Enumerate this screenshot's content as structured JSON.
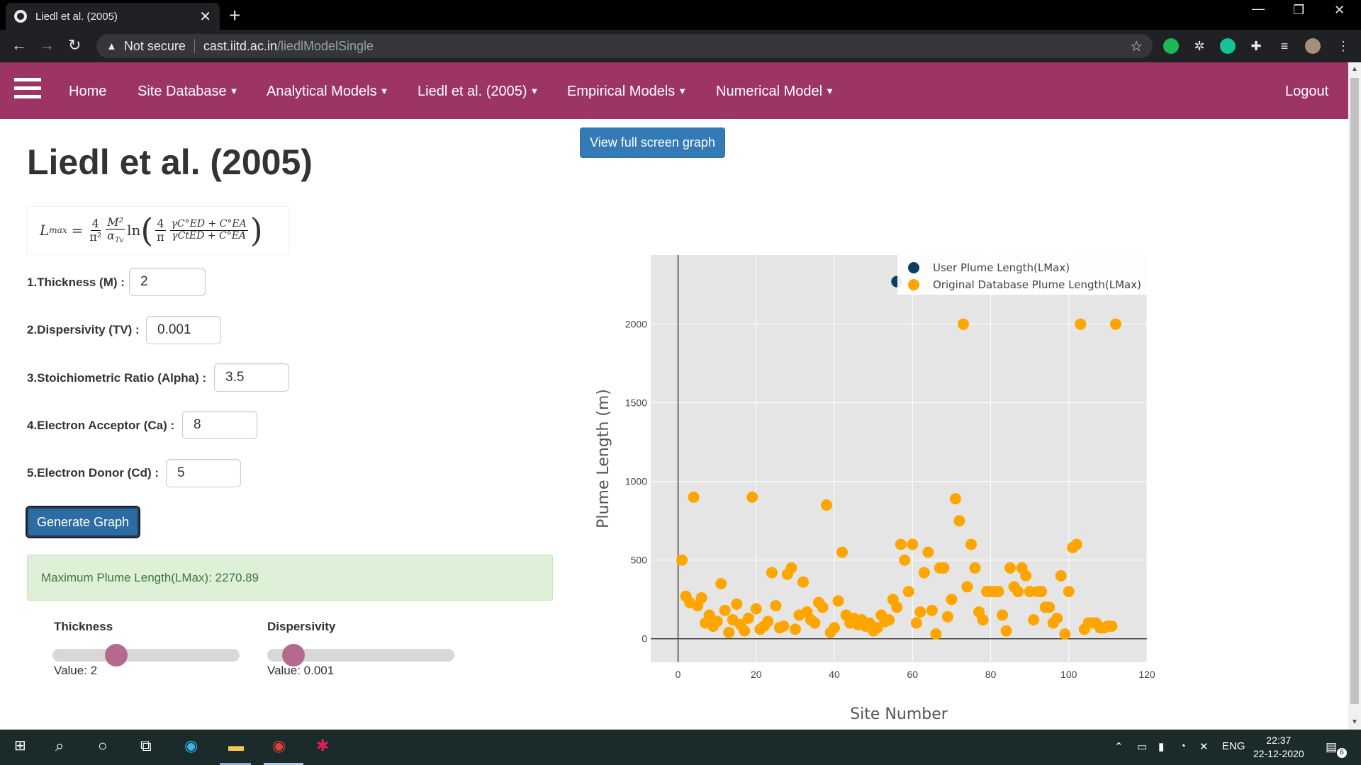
{
  "browser": {
    "tab_title": "Liedl et al. (2005)",
    "tab_close": "✕",
    "new_tab": "+",
    "security_label": "Not secure",
    "url_host": "cast.iitd.ac.in",
    "url_path": "/liedlModelSingle",
    "window_minimize": "—",
    "window_restore": "❐",
    "window_close": "✕"
  },
  "nav": {
    "home": "Home",
    "site_database": "Site Database",
    "analytical_models": "Analytical Models",
    "liedl": "Liedl et al. (2005)",
    "empirical_models": "Empirical Models",
    "numerical_model": "Numerical Model",
    "logout": "Logout"
  },
  "page": {
    "title": "Liedl et al. (2005)",
    "formula": {
      "lhs": "L",
      "lhs_sub": "max",
      "eq": "=",
      "f1_num": "4",
      "f1_den": "π²",
      "f2_num": "M²",
      "f2_den": "α",
      "f2_den_sub": "Tv",
      "ln": "ln",
      "f3_num": "4",
      "f3_den": "π",
      "f4_num": "γC°ED + C°EA",
      "f4_den": "γCtED + C°EA"
    },
    "fields": [
      {
        "label": "1.Thickness (M) :",
        "value": "2"
      },
      {
        "label": "2.Dispersivity (TV) :",
        "value": "0.001"
      },
      {
        "label": "3.Stoichiometric Ratio (Alpha) :",
        "value": "3.5"
      },
      {
        "label": "4.Electron Acceptor (Ca) :",
        "value": "8"
      },
      {
        "label": "5.Electron Donor (Cd) :",
        "value": "5"
      }
    ],
    "generate_button": "Generate Graph",
    "result_text": "Maximum Plume Length(LMax): 2270.89",
    "sliders": [
      {
        "title": "Thickness",
        "value_text": "Value: 2",
        "fraction": 0.34
      },
      {
        "title": "Dispersivity",
        "value_text": "Value: 0.001",
        "fraction": 0.14
      }
    ],
    "fullscreen_button": "View full screen graph"
  },
  "chart_data": {
    "type": "scatter",
    "xlabel": "Site Number",
    "ylabel": "Plume Length (m)",
    "xlim": [
      -7,
      120
    ],
    "ylim": [
      -150,
      2440
    ],
    "xticks": [
      0,
      20,
      40,
      60,
      80,
      100,
      120
    ],
    "yticks": [
      0,
      500,
      1000,
      1500,
      2000
    ],
    "grid": true,
    "legend_position": "top-right",
    "colors": {
      "user": "#0d3f5c",
      "original": "#ffa500",
      "plot_bg": "#e5e5e5"
    },
    "series": [
      {
        "name": "User Plume Length(LMax)",
        "color": "#0d3f5c",
        "points": [
          [
            56,
            2270.89
          ]
        ]
      },
      {
        "name": "Original Database Plume Length(LMax)",
        "color": "#ffa500",
        "points": [
          [
            1,
            500
          ],
          [
            2,
            270
          ],
          [
            3,
            230
          ],
          [
            4,
            900
          ],
          [
            5,
            210
          ],
          [
            6,
            260
          ],
          [
            7,
            100
          ],
          [
            8,
            150
          ],
          [
            9,
            80
          ],
          [
            10,
            110
          ],
          [
            11,
            350
          ],
          [
            12,
            180
          ],
          [
            13,
            40
          ],
          [
            14,
            120
          ],
          [
            15,
            220
          ],
          [
            16,
            90
          ],
          [
            17,
            50
          ],
          [
            18,
            130
          ],
          [
            19,
            900
          ],
          [
            20,
            190
          ],
          [
            21,
            60
          ],
          [
            22,
            80
          ],
          [
            23,
            110
          ],
          [
            24,
            420
          ],
          [
            25,
            210
          ],
          [
            26,
            70
          ],
          [
            27,
            80
          ],
          [
            28,
            410
          ],
          [
            29,
            450
          ],
          [
            30,
            60
          ],
          [
            31,
            150
          ],
          [
            32,
            360
          ],
          [
            33,
            170
          ],
          [
            34,
            120
          ],
          [
            35,
            100
          ],
          [
            36,
            230
          ],
          [
            37,
            200
          ],
          [
            38,
            850
          ],
          [
            39,
            40
          ],
          [
            40,
            70
          ],
          [
            41,
            240
          ],
          [
            42,
            550
          ],
          [
            43,
            150
          ],
          [
            44,
            100
          ],
          [
            45,
            130
          ],
          [
            46,
            90
          ],
          [
            47,
            120
          ],
          [
            48,
            80
          ],
          [
            49,
            100
          ],
          [
            50,
            50
          ],
          [
            51,
            70
          ],
          [
            52,
            150
          ],
          [
            53,
            110
          ],
          [
            54,
            120
          ],
          [
            55,
            250
          ],
          [
            56,
            200
          ],
          [
            57,
            600
          ],
          [
            58,
            500
          ],
          [
            59,
            300
          ],
          [
            60,
            600
          ],
          [
            61,
            100
          ],
          [
            62,
            170
          ],
          [
            63,
            420
          ],
          [
            64,
            550
          ],
          [
            65,
            180
          ],
          [
            66,
            30
          ],
          [
            67,
            450
          ],
          [
            68,
            450
          ],
          [
            69,
            140
          ],
          [
            70,
            250
          ],
          [
            71,
            890
          ],
          [
            72,
            750
          ],
          [
            73,
            2000
          ],
          [
            74,
            330
          ],
          [
            75,
            600
          ],
          [
            76,
            450
          ],
          [
            77,
            170
          ],
          [
            78,
            120
          ],
          [
            79,
            300
          ],
          [
            80,
            300
          ],
          [
            81,
            300
          ],
          [
            82,
            300
          ],
          [
            83,
            150
          ],
          [
            84,
            50
          ],
          [
            85,
            450
          ],
          [
            86,
            330
          ],
          [
            87,
            300
          ],
          [
            88,
            450
          ],
          [
            89,
            400
          ],
          [
            90,
            300
          ],
          [
            91,
            120
          ],
          [
            92,
            300
          ],
          [
            93,
            300
          ],
          [
            94,
            200
          ],
          [
            95,
            200
          ],
          [
            96,
            100
          ],
          [
            97,
            130
          ],
          [
            98,
            400
          ],
          [
            99,
            30
          ],
          [
            100,
            300
          ],
          [
            101,
            580
          ],
          [
            102,
            600
          ],
          [
            103,
            2000
          ],
          [
            104,
            60
          ],
          [
            105,
            100
          ],
          [
            106,
            100
          ],
          [
            107,
            100
          ],
          [
            108,
            70
          ],
          [
            109,
            70
          ],
          [
            110,
            80
          ],
          [
            111,
            80
          ],
          [
            112,
            2000
          ]
        ]
      }
    ]
  },
  "taskbar": {
    "lang": "ENG",
    "time": "22:37",
    "date": "22-12-2020",
    "notif_count": "6"
  }
}
